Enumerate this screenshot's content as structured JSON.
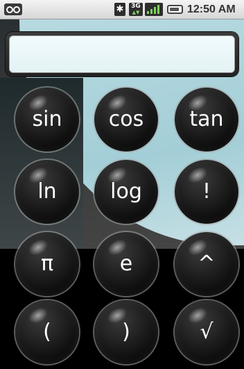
{
  "status_bar": {
    "time": "12:50 AM",
    "icons": [
      "voicemail-icon",
      "bluetooth-icon",
      "3g-icon",
      "signal-icon",
      "battery-icon"
    ],
    "network_label": "3G",
    "bluetooth_glyph": "✱"
  },
  "display": {
    "value": ""
  },
  "keys": [
    {
      "label": "sin"
    },
    {
      "label": "cos"
    },
    {
      "label": "tan"
    },
    {
      "label": "ln"
    },
    {
      "label": "log"
    },
    {
      "label": "!"
    },
    {
      "label": "π"
    },
    {
      "label": "e"
    },
    {
      "label": "^"
    },
    {
      "label": "("
    },
    {
      "label": ")"
    },
    {
      "label": "√"
    }
  ],
  "colors": {
    "accent": "#a9d6df",
    "key_text": "#ffffff",
    "signal": "#7fd35a"
  }
}
